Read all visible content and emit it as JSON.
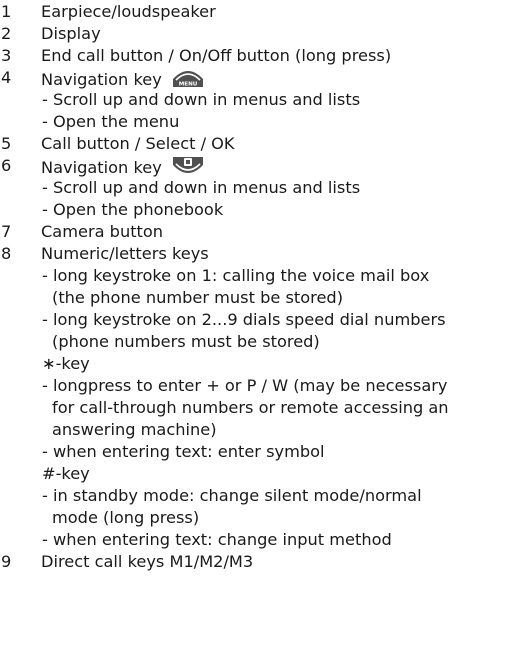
{
  "items": [
    {
      "num": "1",
      "text": "Earpiece/loudspeaker"
    },
    {
      "num": "2",
      "text": "Display"
    },
    {
      "num": "3",
      "text": "End call button / On/Off button (long press)"
    },
    {
      "num": "4",
      "text": "Navigation key",
      "icon": "menu-key-icon",
      "icon_text": "MENU",
      "subs": [
        "- Scroll up and down in menus and lists",
        "- Open the menu"
      ]
    },
    {
      "num": "5",
      "text": "Call button / Select / OK"
    },
    {
      "num": "6",
      "text": "Navigation key",
      "icon": "phonebook-key-icon",
      "subs": [
        "- Scroll up and down in menus and lists",
        "- Open the phonebook"
      ]
    },
    {
      "num": "7",
      "text": "Camera button"
    },
    {
      "num": "8",
      "text": "Numeric/letters keys",
      "subs": [
        "- long keystroke on 1: calling the voice mail box",
        " (the phone number must be stored)",
        "- long keystroke on 2...9 dials speed dial numbers",
        " (phone numbers must be stored)",
        "∗-key",
        "- longpress to enter + or P / W (may be necessary",
        " for call-through numbers or remote accessing an",
        " answering machine)",
        "- when entering text: enter symbol",
        "#-key",
        "- in standby mode: change silent mode/normal",
        " mode (long press)",
        "- when entering text: change input method"
      ]
    },
    {
      "num": "9",
      "text": "Direct call keys M1/M2/M3"
    }
  ],
  "colors": {
    "text": "#1a1a1a",
    "icon_fill": "#505050"
  }
}
